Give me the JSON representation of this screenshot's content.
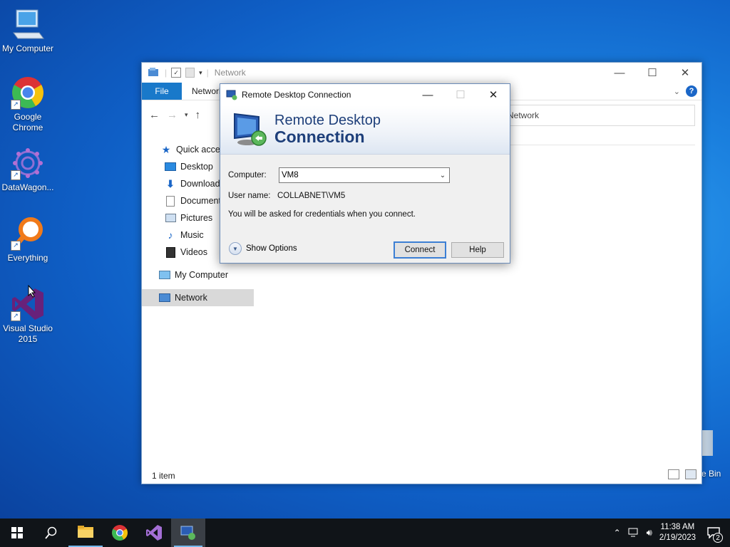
{
  "desktop": {
    "icons": [
      {
        "label": "My Computer"
      },
      {
        "label": "Google Chrome"
      },
      {
        "label": "DataWagon..."
      },
      {
        "label": "Everything"
      },
      {
        "label": "Visual Studio 2015"
      }
    ],
    "recycle_partial_label": "e Bin"
  },
  "explorer": {
    "title": "Network",
    "tabs": {
      "file": "File",
      "network": "Network"
    },
    "address_tail": "Network",
    "nav": [
      {
        "label": "Quick access",
        "icon": "star-icon"
      },
      {
        "label": "Desktop",
        "icon": "desktop-icon"
      },
      {
        "label": "Downloads",
        "icon": "download-icon"
      },
      {
        "label": "Documents",
        "icon": "document-icon"
      },
      {
        "label": "Pictures",
        "icon": "picture-icon"
      },
      {
        "label": "Music",
        "icon": "music-icon"
      },
      {
        "label": "Videos",
        "icon": "video-icon"
      },
      {
        "label": "My Computer",
        "icon": "computer-icon"
      },
      {
        "label": "Network",
        "icon": "network-icon"
      }
    ],
    "status": "1 item"
  },
  "rdp": {
    "window_title": "Remote Desktop Connection",
    "banner_line1": "Remote Desktop",
    "banner_line2": "Connection",
    "computer_label": "Computer:",
    "computer_value": "VM8",
    "username_label": "User name:",
    "username_value": "COLLABNET\\VM5",
    "info": "You will be asked for credentials when you connect.",
    "show_options": "Show Options",
    "connect": "Connect",
    "help": "Help"
  },
  "taskbar": {
    "time": "11:38 AM",
    "date": "2/19/2023",
    "notification_count": "2"
  },
  "colors": {
    "accent": "#1979ca",
    "desktop": "#1a7fde",
    "taskbar": "#101418"
  }
}
